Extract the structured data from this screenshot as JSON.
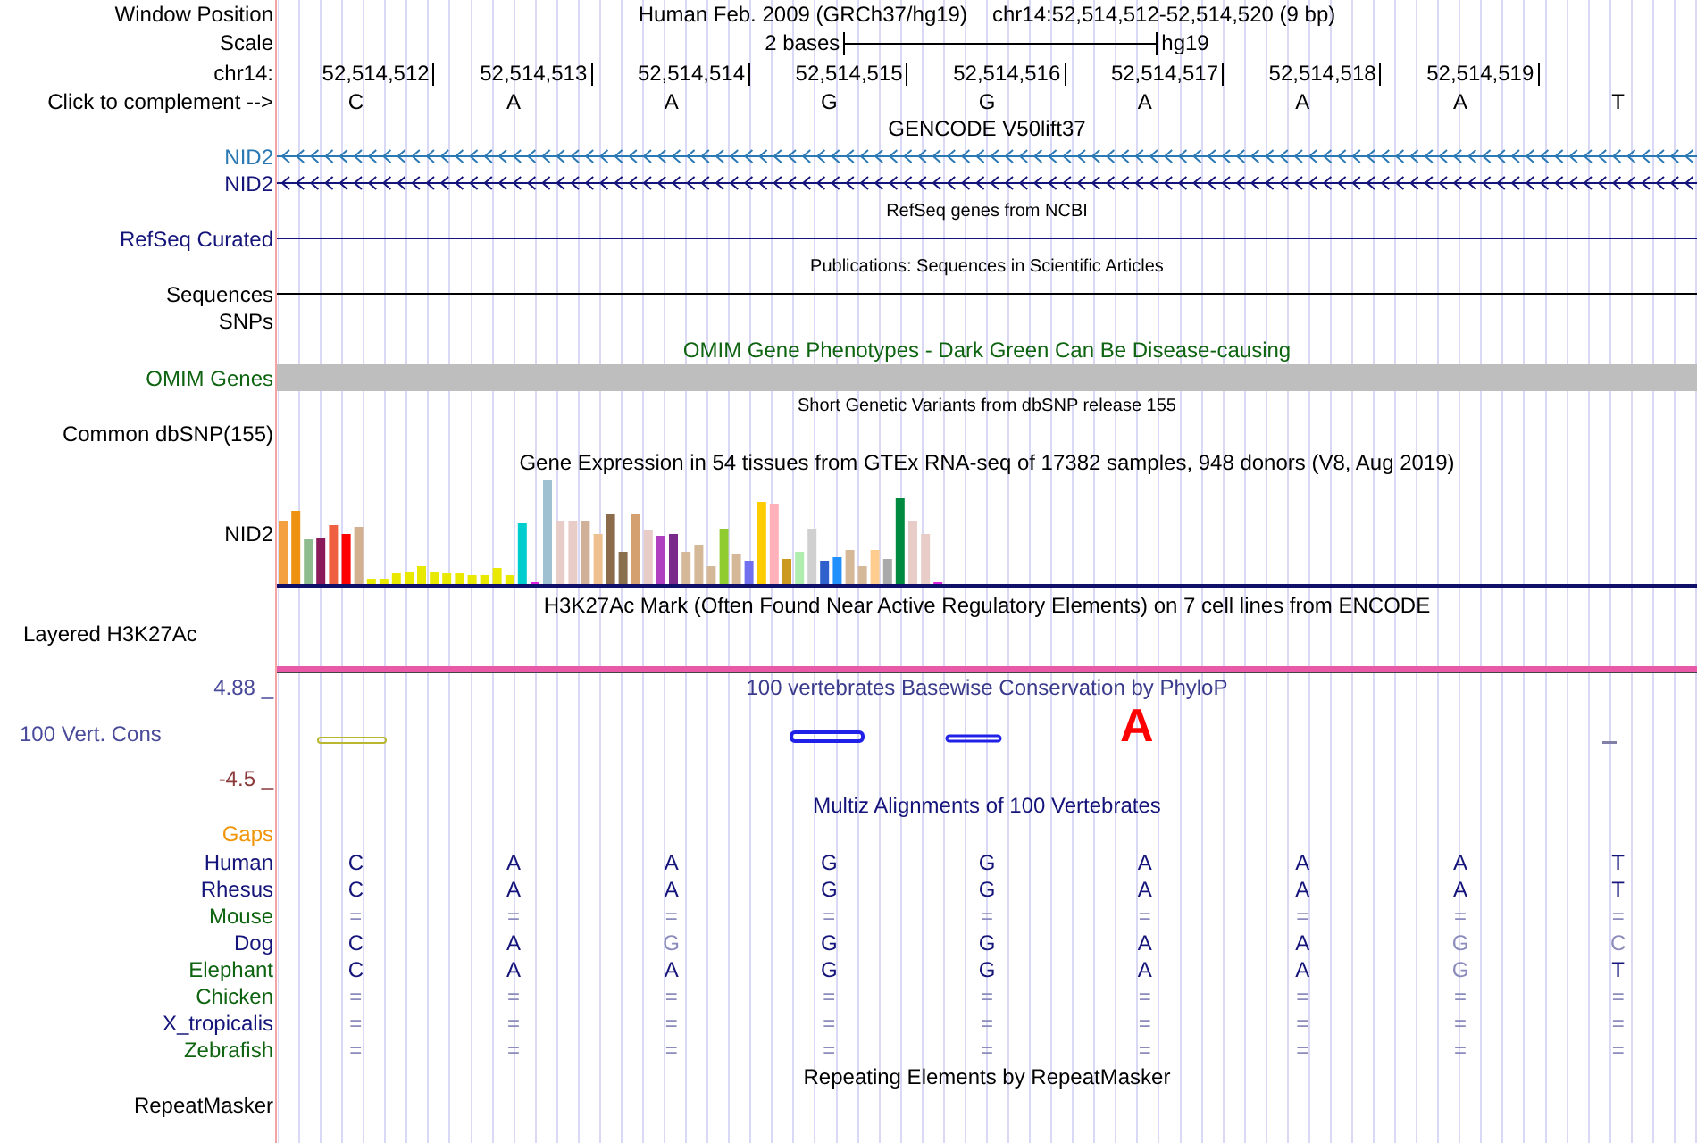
{
  "rows": [
    {
      "kind": "position",
      "label": "Window Position",
      "assembly": "Human Feb. 2009 (GRCh37/hg19)",
      "range": "chr14:52,514,512-52,514,520 (9 bp)"
    },
    {
      "kind": "scale",
      "label": "Scale",
      "span": "2 bases",
      "genome": "hg19"
    },
    {
      "kind": "coords",
      "label": "chr14:",
      "positions": [
        "52,514,512",
        "52,514,513",
        "52,514,514",
        "52,514,515",
        "52,514,516",
        "52,514,517",
        "52,514,518",
        "52,514,519"
      ]
    },
    {
      "kind": "bases",
      "label": "Click to complement -->",
      "bases": [
        "C",
        "A",
        "A",
        "G",
        "G",
        "A",
        "A",
        "A",
        "T"
      ]
    },
    {
      "kind": "title",
      "text": "GENCODE V50lift37",
      "color": "#000000"
    },
    {
      "kind": "gene",
      "label": "NID2",
      "color": "#2a78b4"
    },
    {
      "kind": "gene",
      "label": "NID2",
      "color": "#14147a"
    },
    {
      "kind": "caption",
      "text": "RefSeq genes from NCBI"
    },
    {
      "kind": "line",
      "label": "RefSeq Curated",
      "color": "#14147a"
    },
    {
      "kind": "caption",
      "text": "Publications: Sequences in Scientific Articles"
    },
    {
      "kind": "line",
      "label": "Sequences",
      "color": "#000000"
    },
    {
      "kind": "label",
      "label": "SNPs",
      "color": "#000000"
    },
    {
      "kind": "title",
      "text": "OMIM Gene Phenotypes - Dark Green Can Be Disease-causing",
      "color": "#0e6410"
    },
    {
      "kind": "bar",
      "label": "OMIM Genes",
      "color": "#0e6410"
    },
    {
      "kind": "caption",
      "text": "Short Genetic Variants from dbSNP release 155"
    },
    {
      "kind": "label",
      "label": "Common dbSNP(155)",
      "color": "#000000"
    },
    {
      "kind": "title",
      "text": "Gene Expression in 54 tissues from GTEx RNA-seq of 17382 samples, 948 donors (V8, Aug 2019)",
      "color": "#000000"
    },
    {
      "kind": "expression",
      "label": "NID2"
    },
    {
      "kind": "title",
      "text": "H3K27Ac Mark (Often Found Near Active Regulatory Elements) on 7 cell lines from ENCODE",
      "color": "#000000"
    },
    {
      "kind": "signal",
      "label": "Layered H3K27Ac"
    },
    {
      "kind": "conservation",
      "label": "100 Vert. Cons",
      "max": "4.88 _",
      "min": "-4.5 _",
      "title": "100 vertebrates Basewise Conservation by PhyloP",
      "letter": "A"
    },
    {
      "kind": "title",
      "text": "Multiz Alignments of 100 Vertebrates",
      "color": "#14147a"
    },
    {
      "kind": "label",
      "label": "Gaps",
      "color": "#f0960a"
    },
    {
      "kind": "alignment",
      "label": "Human",
      "color": "#14147a",
      "bases": [
        "C",
        "A",
        "A",
        "G",
        "G",
        "A",
        "A",
        "A",
        "T"
      ],
      "faded": [
        false,
        false,
        false,
        false,
        false,
        false,
        false,
        false,
        false
      ]
    },
    {
      "kind": "alignment",
      "label": "Rhesus",
      "color": "#14147a",
      "bases": [
        "C",
        "A",
        "A",
        "G",
        "G",
        "A",
        "A",
        "A",
        "T"
      ],
      "faded": [
        false,
        false,
        false,
        false,
        false,
        false,
        false,
        false,
        false
      ]
    },
    {
      "kind": "alignment",
      "label": "Mouse",
      "color": "#0e6410",
      "bases": [
        "=",
        "=",
        "=",
        "=",
        "=",
        "=",
        "=",
        "=",
        "="
      ],
      "faded": [
        true,
        true,
        true,
        true,
        true,
        true,
        true,
        true,
        true
      ]
    },
    {
      "kind": "alignment",
      "label": "Dog",
      "color": "#14147a",
      "bases": [
        "C",
        "A",
        "G",
        "G",
        "G",
        "A",
        "A",
        "G",
        "C"
      ],
      "faded": [
        false,
        false,
        true,
        false,
        false,
        false,
        false,
        true,
        true
      ]
    },
    {
      "kind": "alignment",
      "label": "Elephant",
      "color": "#0e6410",
      "bases": [
        "C",
        "A",
        "A",
        "G",
        "G",
        "A",
        "A",
        "G",
        "T"
      ],
      "faded": [
        false,
        false,
        false,
        false,
        false,
        false,
        false,
        true,
        false
      ]
    },
    {
      "kind": "alignment",
      "label": "Chicken",
      "color": "#0e6410",
      "bases": [
        "=",
        "=",
        "=",
        "=",
        "=",
        "=",
        "=",
        "=",
        "="
      ],
      "faded": [
        true,
        true,
        true,
        true,
        true,
        true,
        true,
        true,
        true
      ]
    },
    {
      "kind": "alignment",
      "label": "X_tropicalis",
      "color": "#14147a",
      "bases": [
        "=",
        "=",
        "=",
        "=",
        "=",
        "=",
        "=",
        "=",
        "="
      ],
      "faded": [
        true,
        true,
        true,
        true,
        true,
        true,
        true,
        true,
        true
      ]
    },
    {
      "kind": "alignment",
      "label": "Zebrafish",
      "color": "#0e6410",
      "bases": [
        "=",
        "=",
        "=",
        "=",
        "=",
        "=",
        "=",
        "=",
        "="
      ],
      "faded": [
        true,
        true,
        true,
        true,
        true,
        true,
        true,
        true,
        true
      ]
    },
    {
      "kind": "title",
      "text": "Repeating Elements by RepeatMasker",
      "color": "#000000"
    },
    {
      "kind": "label",
      "label": "RepeatMasker",
      "color": "#000000"
    }
  ]
}
